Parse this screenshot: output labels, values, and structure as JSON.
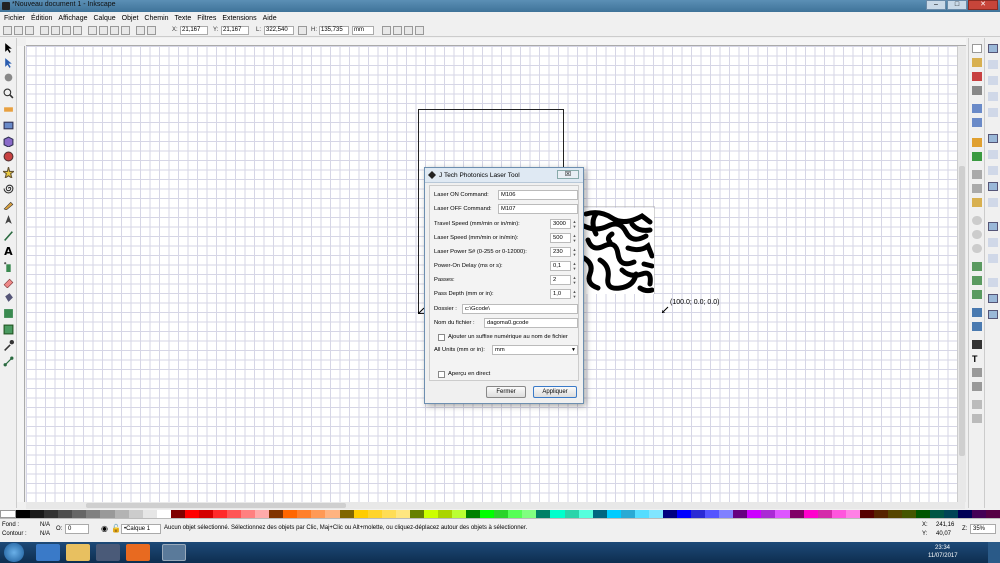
{
  "window": {
    "title": "*Nouveau document 1 - Inkscape"
  },
  "menu": [
    "Fichier",
    "Édition",
    "Affichage",
    "Calque",
    "Objet",
    "Chemin",
    "Texte",
    "Filtres",
    "Extensions",
    "Aide"
  ],
  "toolbar": {
    "x_label": "X:",
    "x_value": "21,167",
    "y_label": "Y:",
    "y_value": "21,167",
    "w_label": "L:",
    "w_value": "322,540",
    "h_label": "H:",
    "h_value": "135,735",
    "unit": "mm"
  },
  "canvas": {
    "coordinate_label": "(100.0; 0.0; 0.0)"
  },
  "dialog": {
    "title": "J Tech Photonics Laser Tool",
    "close": "☒",
    "laser_on_label": "Laser ON Command:",
    "laser_on_value": "M106",
    "laser_off_label": "Laser OFF Command:",
    "laser_off_value": "M107",
    "travel_speed_label": "Travel Speed (mm/min or in/min):",
    "travel_speed_value": "3000",
    "laser_speed_label": "Laser Speed (mm/min or in/min):",
    "laser_speed_value": "500",
    "laser_power_label": "Laser Power S# (0-255 or 0-12000):",
    "laser_power_value": "230",
    "power_on_delay_label": "Power-On Delay (ms or s):",
    "power_on_delay_value": "0,1",
    "passes_label": "Passes:",
    "passes_value": "2",
    "pass_depth_label": "Pass Depth (mm or in):",
    "pass_depth_value": "1,0",
    "folder_label": "Dossier :",
    "folder_value": "c:\\Gcode\\",
    "filename_label": "Nom du fichier :",
    "filename_value": "dagoma0.gcode",
    "suffix_label": "Ajouter un suffixe numérique au nom de fichier",
    "units_label": "All Units (mm or in):",
    "units_value": "mm",
    "preview_label": "Aperçu en direct",
    "close_button": "Fermer",
    "apply_button": "Appliquer"
  },
  "status": {
    "fill_label": "Fond :",
    "fill_value": "N/A",
    "stroke_label": "Contour :",
    "stroke_value": "N/A",
    "opacity_label": "O:",
    "opacity_value": "0",
    "layer": "•Calque 1",
    "message": "Aucun objet sélectionné. Sélectionnez des objets par Clic, Maj+Clic ou Alt+molette, ou cliquez-déplacez autour des objets à sélectionner.",
    "cursor_x_label": "X:",
    "cursor_x": "241,16",
    "cursor_y_label": "Y:",
    "cursor_y": "40,07",
    "zoom_label": "Z:",
    "zoom": "35%"
  },
  "taskbar": {
    "time": "23:34",
    "date": "11/07/2017"
  }
}
